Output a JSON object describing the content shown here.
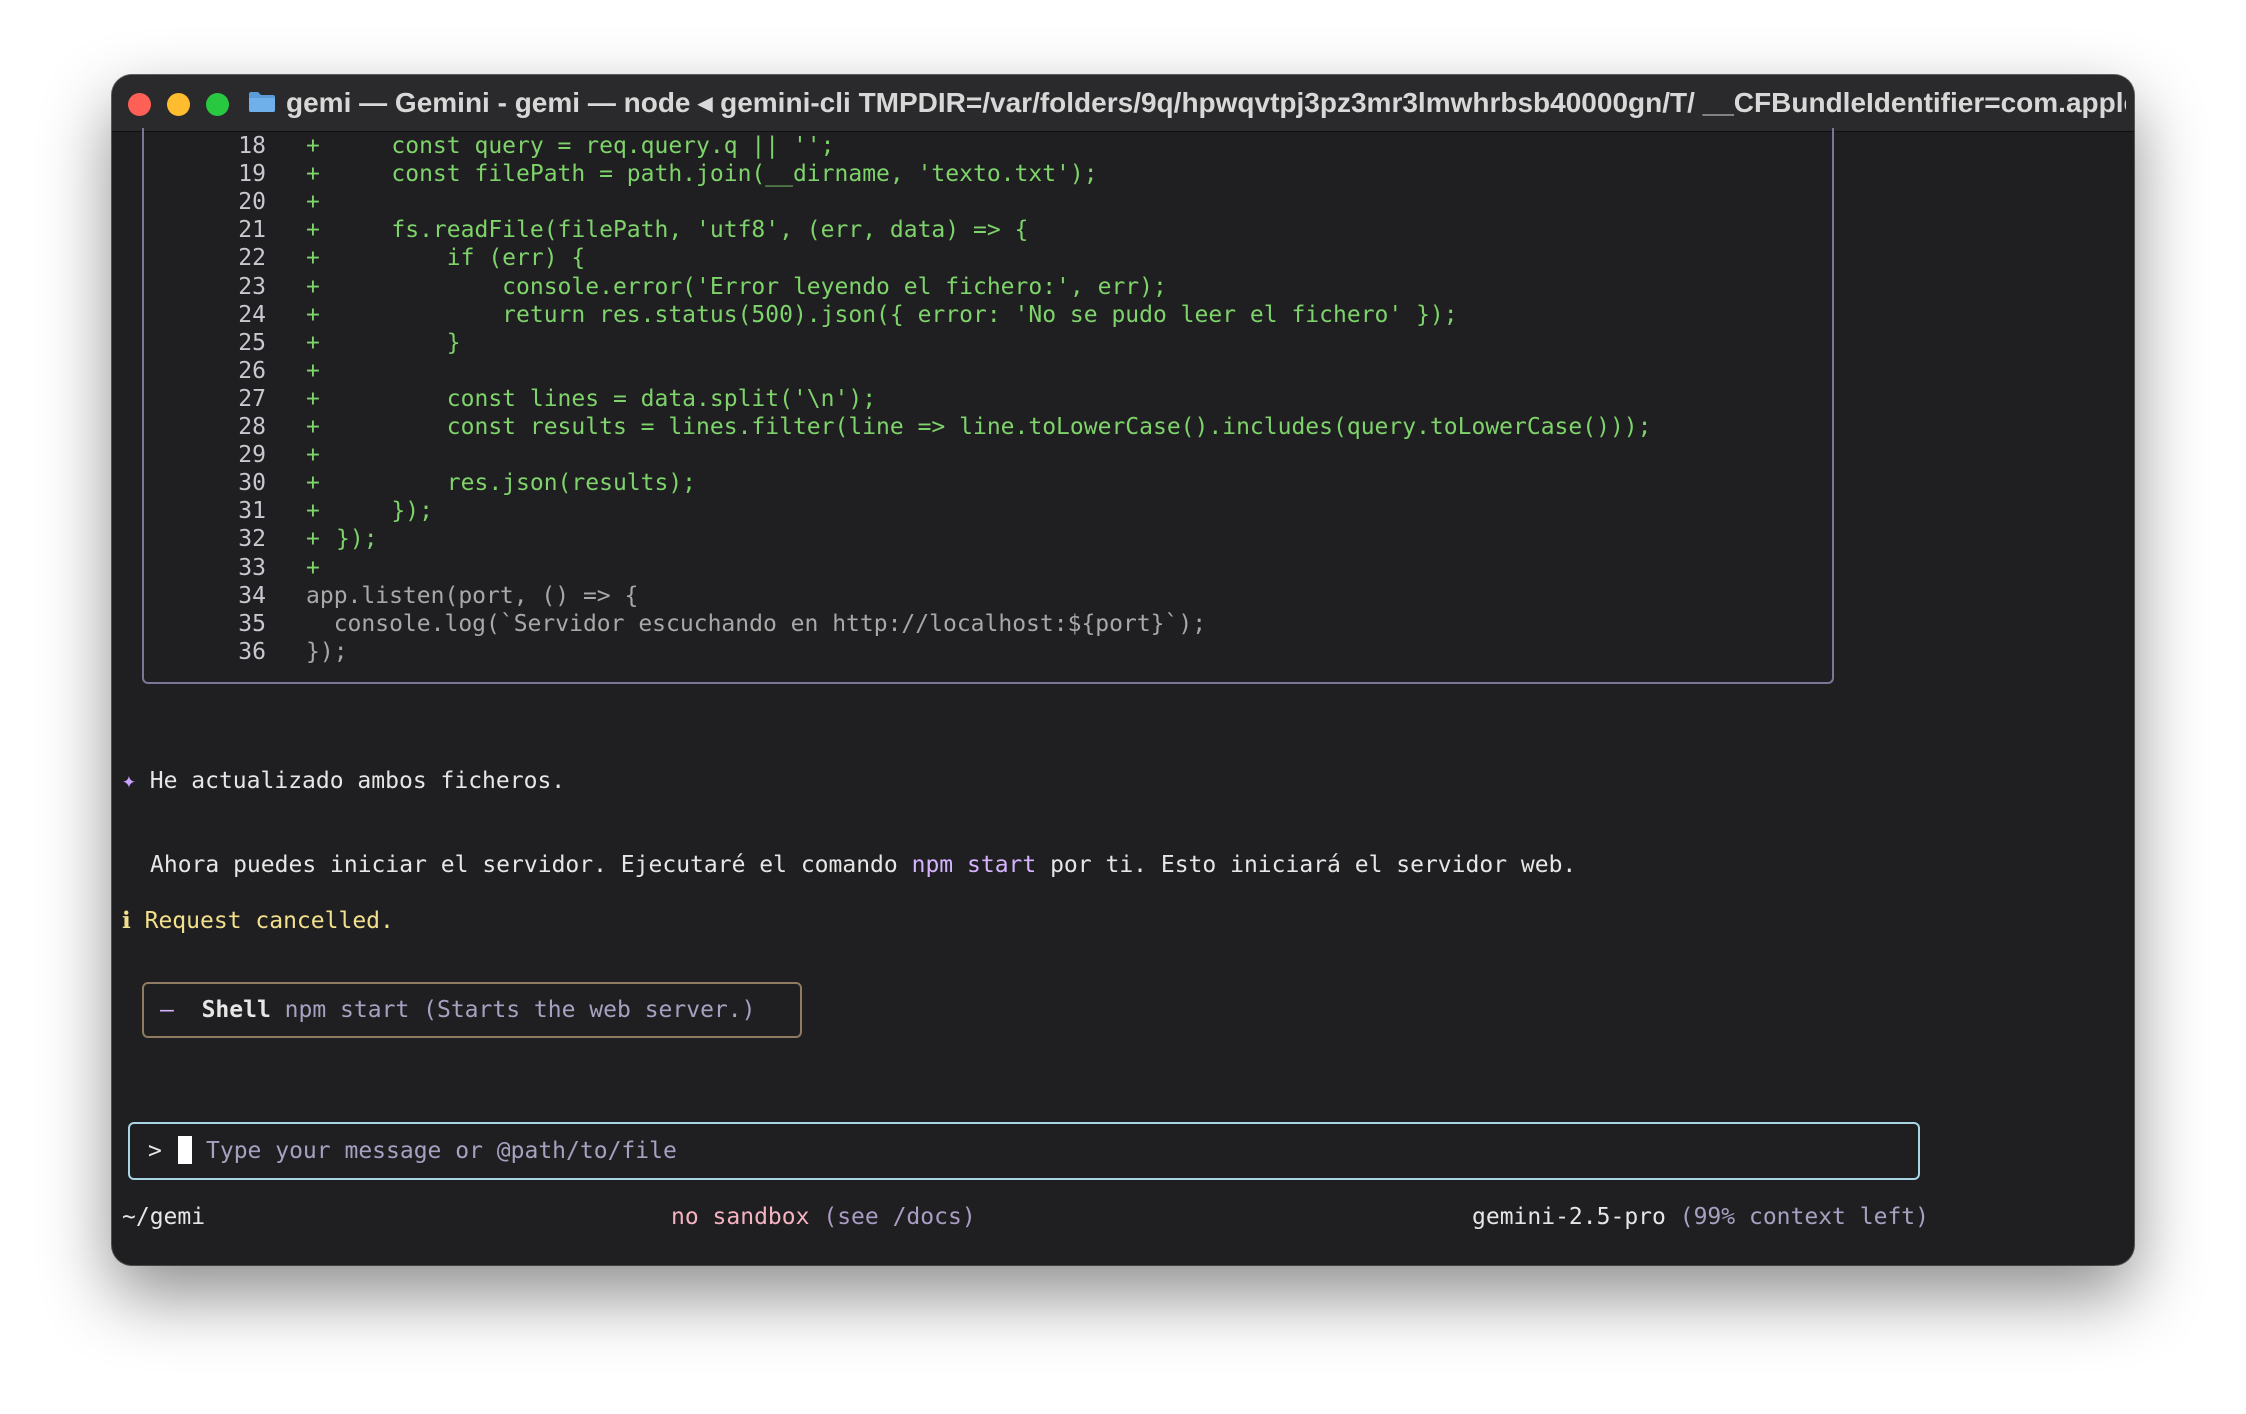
{
  "window": {
    "title": "gemi — Gemini - gemi — node ◂ gemini-cli TMPDIR=/var/folders/9q/hpwqvtpj3pz3mr3lmwhrbsb40000gn/T/ __CFBundleIdentifier=com.apple.T..."
  },
  "diff": {
    "lines": [
      {
        "n": "18",
        "sign": "+",
        "text": "    const query = req.query.q || '';",
        "kind": "added"
      },
      {
        "n": "19",
        "sign": "+",
        "text": "    const filePath = path.join(__dirname, 'texto.txt');",
        "kind": "added"
      },
      {
        "n": "20",
        "sign": "+",
        "text": "",
        "kind": "added"
      },
      {
        "n": "21",
        "sign": "+",
        "text": "    fs.readFile(filePath, 'utf8', (err, data) => {",
        "kind": "added"
      },
      {
        "n": "22",
        "sign": "+",
        "text": "        if (err) {",
        "kind": "added"
      },
      {
        "n": "23",
        "sign": "+",
        "text": "            console.error('Error leyendo el fichero:', err);",
        "kind": "added"
      },
      {
        "n": "24",
        "sign": "+",
        "text": "            return res.status(500).json({ error: 'No se pudo leer el fichero' });",
        "kind": "added"
      },
      {
        "n": "25",
        "sign": "+",
        "text": "        }",
        "kind": "added"
      },
      {
        "n": "26",
        "sign": "+",
        "text": "",
        "kind": "added"
      },
      {
        "n": "27",
        "sign": "+",
        "text": "        const lines = data.split('\\n');",
        "kind": "added"
      },
      {
        "n": "28",
        "sign": "+",
        "text": "        const results = lines.filter(line => line.toLowerCase().includes(query.toLowerCase()));",
        "kind": "added"
      },
      {
        "n": "29",
        "sign": "+",
        "text": "",
        "kind": "added"
      },
      {
        "n": "30",
        "sign": "+",
        "text": "        res.json(results);",
        "kind": "added"
      },
      {
        "n": "31",
        "sign": "+",
        "text": "    });",
        "kind": "added"
      },
      {
        "n": "32",
        "sign": "+",
        "text": "});",
        "kind": "added"
      },
      {
        "n": "33",
        "sign": "+",
        "text": "",
        "kind": "added"
      },
      {
        "n": "34",
        "sign": "",
        "text": "app.listen(port, () => {",
        "kind": "ctx"
      },
      {
        "n": "35",
        "sign": "",
        "text": "  console.log(`Servidor escuchando en http://localhost:${port}`);",
        "kind": "ctx"
      },
      {
        "n": "36",
        "sign": "",
        "text": "});",
        "kind": "ctx"
      }
    ]
  },
  "messages": {
    "update_marker": "✦",
    "update_text": "He actualizado ambos ficheros.",
    "run_prefix": "Ahora puedes iniciar el servidor. Ejecutaré el comando ",
    "run_command": "npm start",
    "run_suffix": " por ti. Esto iniciará el servidor web.",
    "info_marker": "ℹ",
    "info_text": "Request cancelled."
  },
  "tool": {
    "marker": "–",
    "name": "Shell",
    "description": "npm start (Starts the web server.)"
  },
  "input": {
    "prompt": ">",
    "placeholder": "Type your message or @path/to/file"
  },
  "footer": {
    "cwd": "~/gemi",
    "sandbox": "no sandbox",
    "sandbox_hint": "(see /docs)",
    "model": "gemini-2.5-pro",
    "context": "(99% context left)"
  },
  "colors": {
    "added": "#7ed36a",
    "context": "#a8a8a8",
    "diff_border": "#7b7596",
    "input_border": "#a8d4e6",
    "tool_border": "#8e7b62",
    "accent": "#d4b4ff",
    "info": "#f2e08c"
  }
}
